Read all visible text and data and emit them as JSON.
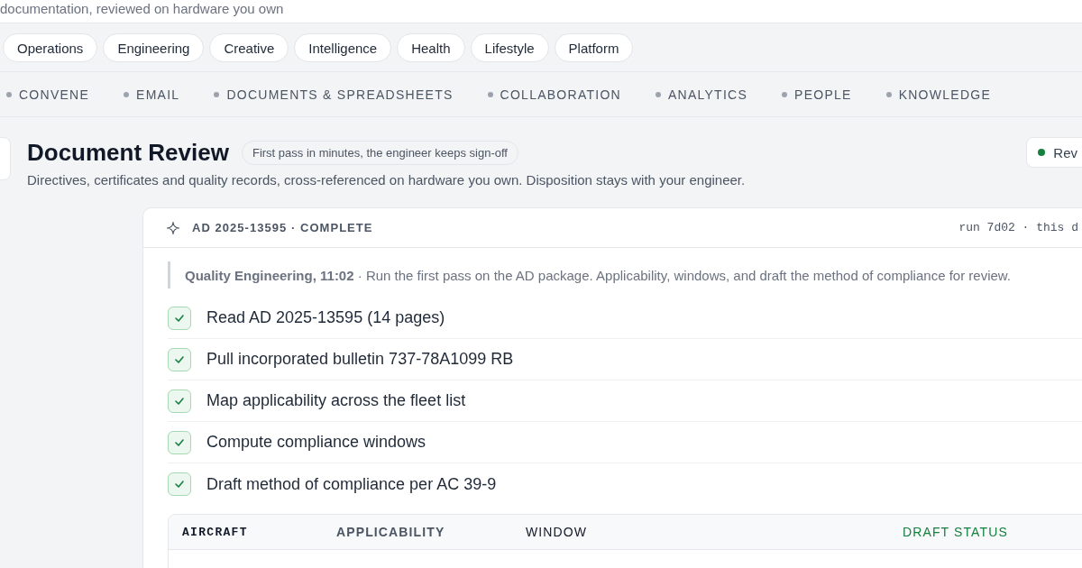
{
  "intro": {
    "text": "documentation, reviewed on hardware you own"
  },
  "suites": [
    {
      "label": "Operations",
      "selected": false
    },
    {
      "label": "Engineering",
      "selected": false
    },
    {
      "label": "Creative",
      "selected": false
    },
    {
      "label": "Intelligence",
      "selected": false
    },
    {
      "label": "Health",
      "selected": false
    },
    {
      "label": "Lifestyle",
      "selected": false
    },
    {
      "label": "Platform",
      "selected": false
    }
  ],
  "categories": [
    {
      "label": "CONVENE",
      "selected": false
    },
    {
      "label": "EMAIL",
      "selected": false
    },
    {
      "label": "DOCUMENTS & SPREADSHEETS",
      "selected": false
    },
    {
      "label": "COLLABORATION",
      "selected": false
    },
    {
      "label": "ANALYTICS",
      "selected": false
    },
    {
      "label": "PEOPLE",
      "selected": false
    },
    {
      "label": "KNOWLEDGE",
      "selected": false
    }
  ],
  "header": {
    "title": "Document Review",
    "badge": "First pass in minutes, the engineer keeps sign-off",
    "subtitle": "Directives, certificates and quality records, cross-referenced on hardware you own. Disposition stays with your engineer.",
    "status": "Rev"
  },
  "run": {
    "title": "AD 2025-13595 · COMPLETE",
    "meta": "run 7d02 · this d",
    "note": "**Quality Engineering, 11:02** · Run the first pass on the AD package. Applicability, windows, and draft the method of compliance for review.",
    "steps": [
      {
        "label": "Read AD 2025-13595 (14 pages)",
        "checked": true
      },
      {
        "label": "Pull incorporated bulletin 737-78A1099 RB",
        "checked": true
      },
      {
        "label": "Map applicability across the fleet list",
        "checked": true
      },
      {
        "label": "Compute compliance windows",
        "checked": true
      },
      {
        "label": "Draft method of compliance per AC 39-9",
        "checked": true
      }
    ],
    "table": {
      "columns": [
        {
          "label": "AIRCRAFT",
          "kind": "mono"
        },
        {
          "label": "APPLICABILITY",
          "kind": "muted"
        },
        {
          "label": "WINDOW",
          "kind": "strong"
        },
        {
          "label": "DRAFT STATUS",
          "kind": "status"
        }
      ]
    }
  }
}
